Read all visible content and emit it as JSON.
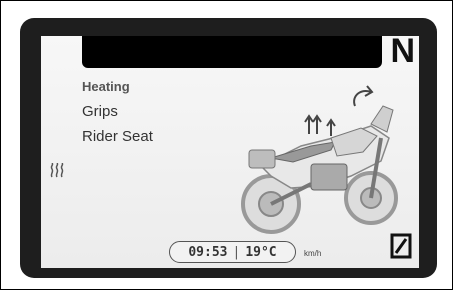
{
  "display": {
    "gear": "N",
    "menu": {
      "heading": "Heating",
      "items": [
        "Grips",
        "Rider Seat"
      ]
    },
    "status": {
      "time": "09:53",
      "temperature": "19°C",
      "speed_unit": "km/h"
    },
    "icons": {
      "heat_indicator": "seat-heating-icon",
      "bike_heat_grips": "grip-heat-arrows-icon",
      "bike_heat_seat": "seat-heat-arrows-icon",
      "box_indicator": "zero-box-icon"
    },
    "colors": {
      "bezel": "#1e1e1e",
      "screen": "#f2f2f2",
      "text": "#333333"
    }
  }
}
